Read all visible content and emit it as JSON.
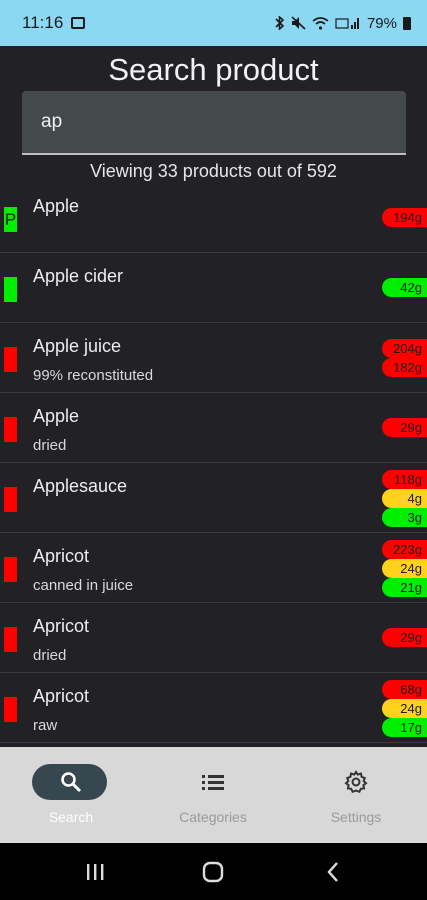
{
  "status_bar": {
    "time": "11:16",
    "battery": "79%"
  },
  "page_title": "Search product",
  "search": {
    "value": "ap",
    "placeholder": ""
  },
  "result_count": "Viewing 33 products out of 592",
  "colors": {
    "red": "#ff0000",
    "green": "#00ee00",
    "yellow": "#ffd21c",
    "nav_pill": "#37474f"
  },
  "products": [
    {
      "name": "Apple",
      "subtitle": "",
      "flag": "green",
      "flag_letter": "P",
      "pills": [
        {
          "text": "194g",
          "color": "red"
        }
      ]
    },
    {
      "name": "Apple cider",
      "subtitle": "",
      "flag": "green",
      "flag_letter": "",
      "pills": [
        {
          "text": "42g",
          "color": "green"
        }
      ]
    },
    {
      "name": "Apple juice",
      "subtitle": "99% reconstituted",
      "flag": "red",
      "flag_letter": "",
      "pills": [
        {
          "text": "204g",
          "color": "red"
        },
        {
          "text": "182g",
          "color": "red"
        }
      ]
    },
    {
      "name": "Apple",
      "subtitle": "dried",
      "flag": "red",
      "flag_letter": "",
      "pills": [
        {
          "text": "29g",
          "color": "red"
        }
      ]
    },
    {
      "name": "Applesauce",
      "subtitle": "",
      "flag": "red",
      "flag_letter": "",
      "pills": [
        {
          "text": "118g",
          "color": "red"
        },
        {
          "text": "4g",
          "color": "yellow"
        },
        {
          "text": "3g",
          "color": "green"
        }
      ]
    },
    {
      "name": "Apricot",
      "subtitle": "canned in juice",
      "flag": "red",
      "flag_letter": "",
      "pills": [
        {
          "text": "223g",
          "color": "red"
        },
        {
          "text": "24g",
          "color": "yellow"
        },
        {
          "text": "21g",
          "color": "green"
        }
      ]
    },
    {
      "name": "Apricot",
      "subtitle": "dried",
      "flag": "red",
      "flag_letter": "",
      "pills": [
        {
          "text": "29g",
          "color": "red"
        }
      ]
    },
    {
      "name": "Apricot",
      "subtitle": "raw",
      "flag": "red",
      "flag_letter": "",
      "pills": [
        {
          "text": "68g",
          "color": "red"
        },
        {
          "text": "24g",
          "color": "yellow"
        },
        {
          "text": "17g",
          "color": "green"
        }
      ]
    }
  ],
  "bottom_nav": [
    {
      "label": "Search",
      "icon": "search-icon",
      "active": true
    },
    {
      "label": "Categories",
      "icon": "list-icon",
      "active": false
    },
    {
      "label": "Settings",
      "icon": "gear-icon",
      "active": false
    }
  ]
}
